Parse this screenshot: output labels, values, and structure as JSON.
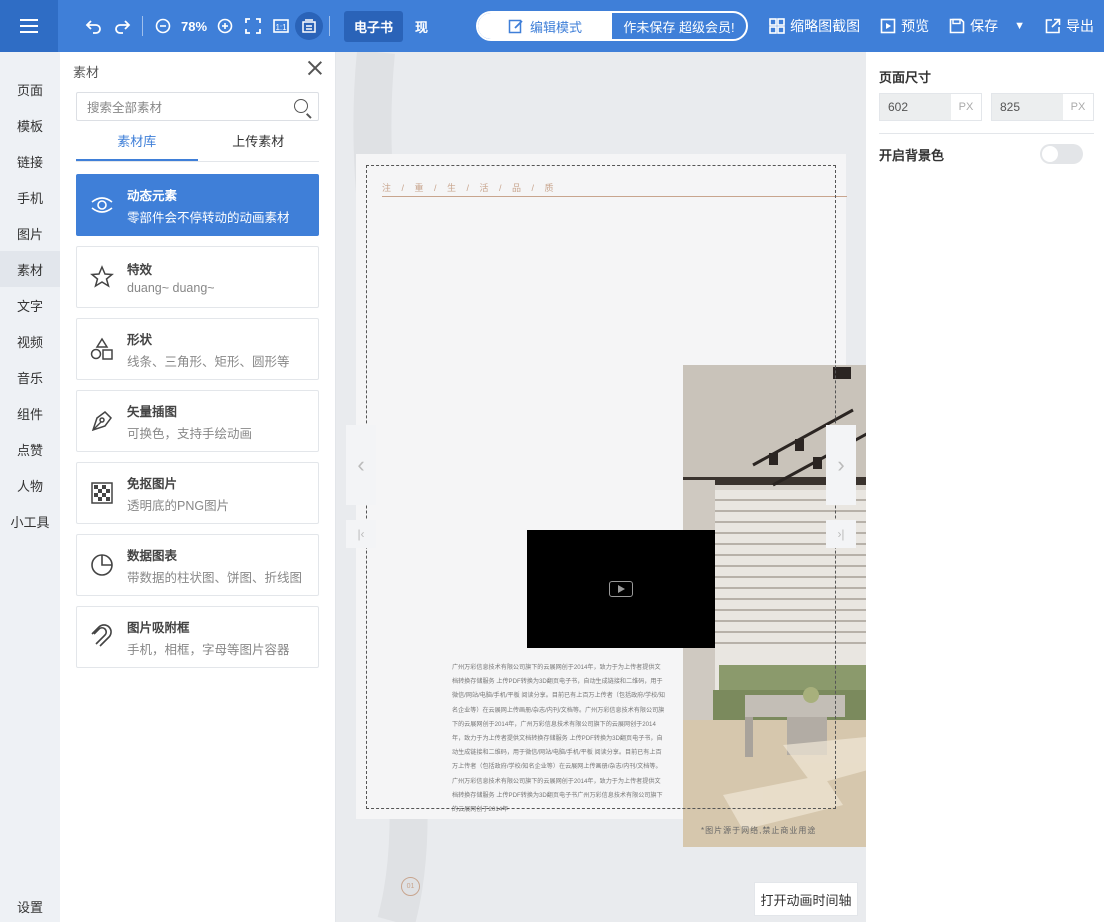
{
  "toolbar": {
    "zoom": "78%",
    "ebook_label": "电子书",
    "now_label": "现",
    "edit_mode_label": "编辑模式",
    "right_pill_label": "作未保存   超级会员!",
    "thumbnail_label": "缩略图截图",
    "preview_label": "预览",
    "save_label": "保存",
    "export_label": "导出"
  },
  "leftnav": {
    "items": [
      "页面",
      "模板",
      "链接",
      "手机",
      "图片",
      "素材",
      "文字",
      "视频",
      "音乐",
      "组件",
      "点赞",
      "人物",
      "小工具"
    ],
    "active_index": 5,
    "settings_label": "设置"
  },
  "panel": {
    "title": "素材",
    "search_placeholder": "搜索全部素材",
    "tabs": [
      "素材库",
      "上传素材"
    ],
    "cards": [
      {
        "title": "动态元素",
        "subtitle": "零部件会不停转动的动画素材",
        "icon": "gear-animation-icon"
      },
      {
        "title": "特效",
        "subtitle": "duang~ duang~",
        "icon": "sparkle-star-icon"
      },
      {
        "title": "形状",
        "subtitle": "线条、三角形、矩形、圆形等",
        "icon": "shapes-icon"
      },
      {
        "title": "矢量插图",
        "subtitle": "可换色，支持手绘动画",
        "icon": "pen-nib-icon"
      },
      {
        "title": "免抠图片",
        "subtitle": "透明底的PNG图片",
        "icon": "transparent-grid-icon"
      },
      {
        "title": "数据图表",
        "subtitle": "带数据的柱状图、饼图、折线图",
        "icon": "pie-chart-icon"
      },
      {
        "title": "图片吸附框",
        "subtitle": "手机，相框，字母等图片容器",
        "icon": "magnet-icon"
      }
    ]
  },
  "canvas": {
    "header_text": "注 / 重 / 生 / 活 / 品 / 质",
    "body_text": "广州万彩信息技术有限公司旗下的云展网创于2014年，致力于为上传者提供文档转换存储服务 上传PDF转换为3D翻页电子书，自动生成链接和二维码，用于微信/网站/电脑/手机/平板 阅读分享。目前已有上百万上传者（包括政府/学校/知名企业等）在云展网上传画册/杂志/内刊/文档等。广州万彩信息技术有限公司旗下的云展网创于2014年，广州万彩信息技术有限公司旗下的云展网创于2014年，致力于为上传者提供文档转换存储服务 上传PDF转换为3D翻页电子书，自动生成链接和二维码，用于微信/网站/电脑/手机/平板 阅读分享。目前已有上百万上传者（包括政府/学校/知名企业等）在云展网上传画册/杂志/内刊/文档等。广州万彩信息技术有限公司旗下的云展网创于2014年，致力于为上传者提供文档转换存储服务 上传PDF转换为3D翻页电子书广州万彩信息技术有限公司旗下的云展网创于2014年",
    "caption": "*图片源于网络,禁止商业用途",
    "page_number": "01",
    "timeline_button": "打开动画时间轴"
  },
  "rpanel": {
    "size_title": "页面尺寸",
    "width": "602",
    "height": "825",
    "unit": "PX",
    "bg_label": "开启背景色",
    "bg_enabled": false
  },
  "colors": {
    "brand": "#3f7fd8",
    "accent_gold": "#c8a58e"
  }
}
